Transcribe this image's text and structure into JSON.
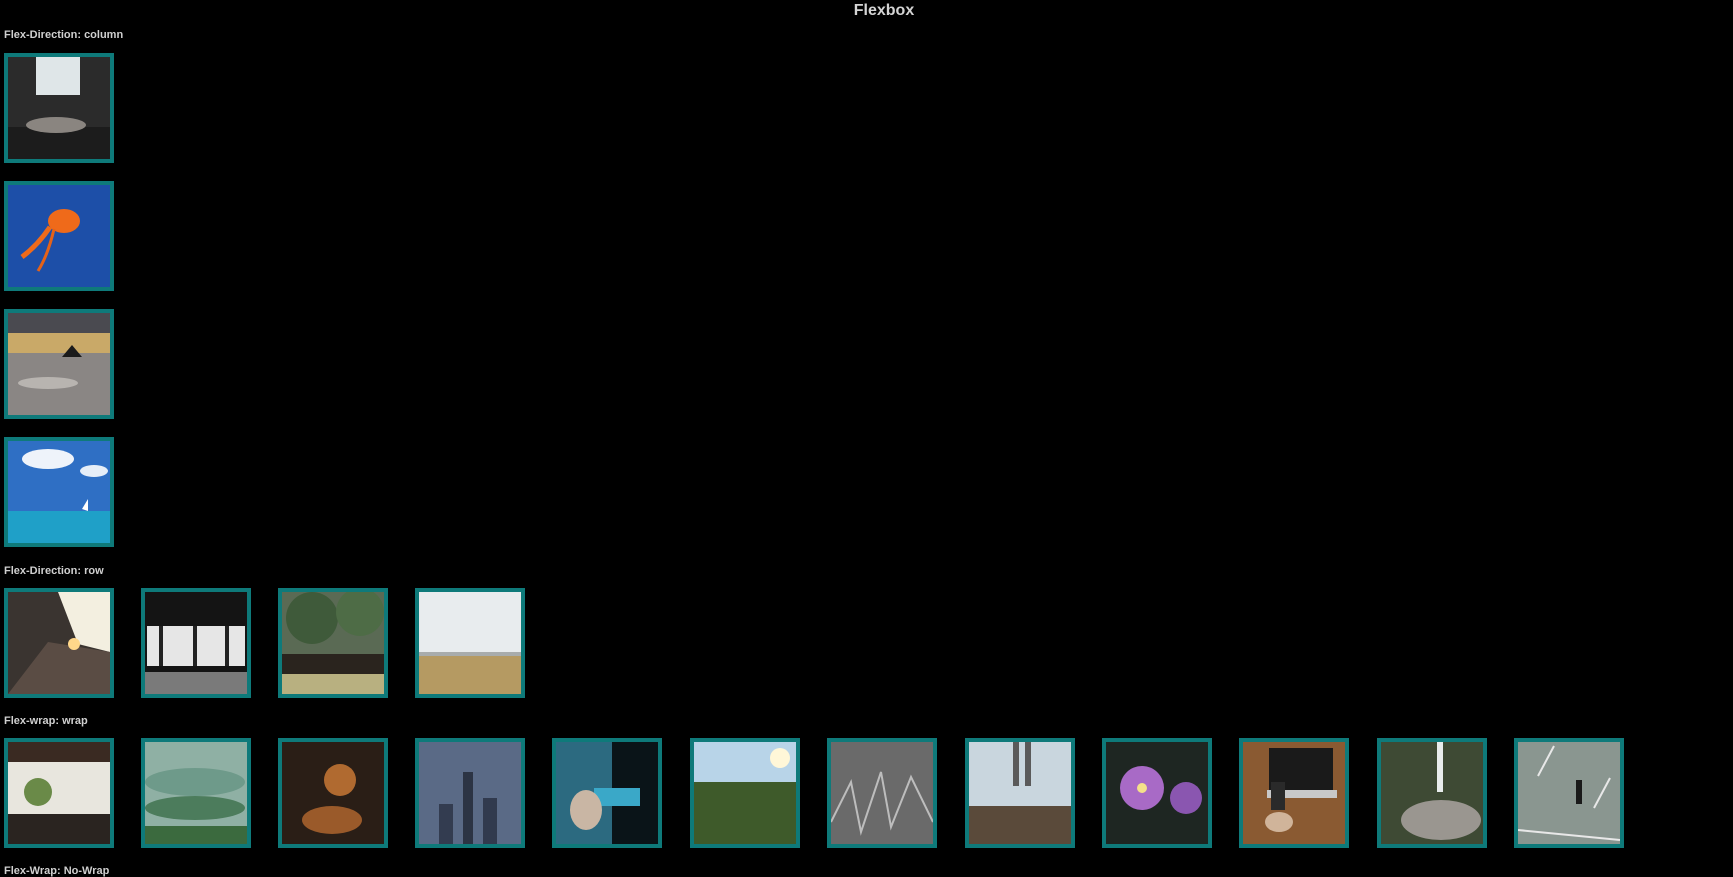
{
  "page": {
    "title": "Flexbox"
  },
  "sections": {
    "column": {
      "label": "Flex-Direction: column"
    },
    "row": {
      "label": "Flex-Direction: row"
    },
    "wrap": {
      "label": "Flex-wrap: wrap"
    },
    "nowrap": {
      "label": "Flex-Wrap: No-Wrap"
    }
  },
  "colors": {
    "background": "#000000",
    "tile_border": "#0e7a7a",
    "text": "#d4d4d4"
  },
  "tiles": {
    "column": [
      "window-bedroom-photo",
      "orange-jellyfish-photo",
      "rocky-beach-sunset-photo",
      "blue-sea-sky-photo"
    ],
    "row": [
      "pier-sunset-photo",
      "dark-window-room-photo",
      "grass-field-trees-photo",
      "beach-dune-grass-photo"
    ],
    "wrap": [
      "car-interior-photo",
      "misty-green-hills-photo",
      "tiger-cub-photo",
      "city-skyline-photo",
      "hand-holding-phone-photo",
      "meadow-sunlight-photo",
      "grayscale-grass-photo",
      "legs-on-cliff-photo",
      "purple-flowers-photo",
      "laptop-phone-photo",
      "waterfall-rocks-photo",
      "person-walking-road-photo"
    ]
  }
}
